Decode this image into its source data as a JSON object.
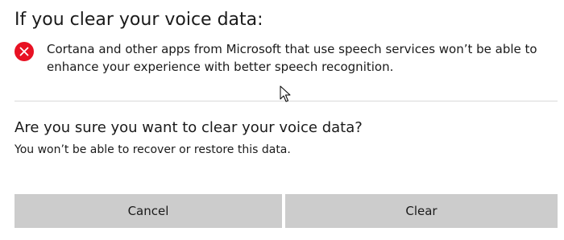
{
  "dialog": {
    "heading": "If you clear your voice data:",
    "warning": {
      "icon": "error-icon",
      "icon_color": "#e81123",
      "text": "Cortana and other apps from Microsoft that use speech services won’t be able to enhance your experience with better speech recognition."
    },
    "question": "Are you sure you want to clear your voice data?",
    "note": "You won’t be able to recover or restore this data.",
    "buttons": {
      "cancel_label": "Cancel",
      "clear_label": "Clear"
    }
  },
  "colors": {
    "background": "#ffffff",
    "button_bg": "#cccccc",
    "divider": "#d9d9d9"
  }
}
